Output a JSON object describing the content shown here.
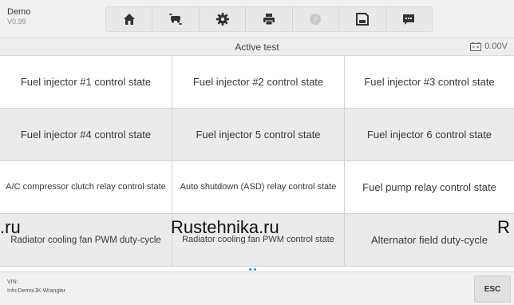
{
  "brand": {
    "name": "Demo",
    "version": "V0.99"
  },
  "toolbar": [
    {
      "icon": "home-icon"
    },
    {
      "icon": "vehicle-swap-icon"
    },
    {
      "icon": "gear-icon"
    },
    {
      "icon": "printer-icon"
    },
    {
      "icon": "help-icon"
    },
    {
      "icon": "save-icon"
    },
    {
      "icon": "message-icon"
    }
  ],
  "title": "Active test",
  "battery": {
    "icon": "battery-icon",
    "voltage": "0.00V"
  },
  "tests": [
    "Fuel injector #1 control state",
    "Fuel injector #2 control state",
    "Fuel injector #3 control state",
    "Fuel injector #4 control state",
    "Fuel injector 5 control state",
    "Fuel injector 6 control state",
    "A/C compressor clutch relay control state",
    "Auto shutdown (ASD) relay control state",
    "Fuel pump relay control state",
    "Radiator cooling fan PWM duty-cycle",
    "Radiator cooling fan PWM control state",
    "Alternator field duty-cycle"
  ],
  "watermark": ".ru",
  "watermark_main": "Rustehnika.ru",
  "watermark_right": "R",
  "footer": {
    "vin": "VIN:",
    "info": "Info:Demo/JK-Wrangler"
  },
  "esc_label": "ESC",
  "colors": {
    "accent": "#4a7cd6",
    "shade": "#ebebeb"
  }
}
